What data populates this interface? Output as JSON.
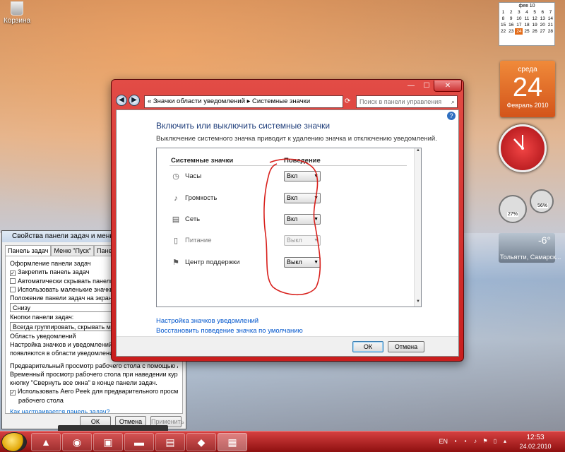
{
  "desktop": {
    "recycle_bin_label": "Корзина"
  },
  "gadgets": {
    "calendar_mini": {
      "month": "фев 10",
      "weeks": [
        [
          "1",
          "2",
          "3",
          "4",
          "5",
          "6",
          "7"
        ],
        [
          "8",
          "9",
          "10",
          "11",
          "12",
          "13",
          "14"
        ],
        [
          "15",
          "16",
          "17",
          "18",
          "19",
          "20",
          "21"
        ],
        [
          "22",
          "23",
          "24",
          "25",
          "26",
          "27",
          "28"
        ]
      ],
      "selected": "24"
    },
    "calendar_big": {
      "weekday": "среда",
      "day": "24",
      "month_year": "Февраль 2010"
    },
    "meter": {
      "cpu": "27%",
      "ram": "56%"
    },
    "weather": {
      "temp": "-6°",
      "city": "Тольятти, Самарск..."
    }
  },
  "props_dialog": {
    "title": "Свойства панели задач и меню \"Пуск\"",
    "tabs": [
      "Панель задач",
      "Меню \"Пуск\"",
      "Панели инстр"
    ],
    "section1": "Оформление панели задач",
    "checks": [
      {
        "label": "Закрепить панель задач",
        "checked": true
      },
      {
        "label": "Автоматически скрывать панель задач",
        "checked": false
      },
      {
        "label": "Использовать маленькие значки",
        "checked": false
      }
    ],
    "position_label": "Положение панели задач на экране:",
    "position_value": "Снизу",
    "buttons_label": "Кнопки панели задач:",
    "buttons_value": "Всегда группировать, скрывать метки",
    "notify_section": "Область уведомлений",
    "notify_text1": "Настройка значков и уведомлений, котор",
    "notify_text2": "появляются в области уведомлений.",
    "aero_section": "Предварительный просмотр рабочего стола с помощью Aero Peek",
    "aero_text1": "Временный просмотр рабочего стола при наведении курсора на",
    "aero_text2": "кнопку \"Свернуть все окна\" в конце панели задач.",
    "aero_check1": "Использовать Aero Peek для предварительного просмотра",
    "aero_check2": "рабочего стола",
    "help_link": "Как настраивается панель задач?",
    "ok": "ОК",
    "cancel": "Отмена",
    "apply": "Применить"
  },
  "main_window": {
    "breadcrumb": "« Значки области уведомлений ▸ Системные значки",
    "search_placeholder": "Поиск в панели управления",
    "heading": "Включить или выключить системные значки",
    "description": "Выключение системного значка приводит к удалению значка и отключению уведомлений.",
    "col_icons": "Системные значки",
    "col_behavior": "Поведение",
    "rows": [
      {
        "name": "Часы",
        "value": "Вкл",
        "icon": "clock-icon",
        "enabled": true
      },
      {
        "name": "Громкость",
        "value": "Вкл",
        "icon": "speaker-icon",
        "enabled": true
      },
      {
        "name": "Сеть",
        "value": "Вкл",
        "icon": "network-icon",
        "enabled": true
      },
      {
        "name": "Питание",
        "value": "Выкл",
        "icon": "power-icon",
        "enabled": false
      },
      {
        "name": "Центр поддержки",
        "value": "Выкл",
        "icon": "flag-icon",
        "enabled": true
      }
    ],
    "link_customize": "Настройка значков уведомлений",
    "link_restore": "Восстановить поведение значка по умолчанию",
    "ok": "ОК",
    "cancel": "Отмена"
  },
  "taskbar": {
    "lang": "EN",
    "time": "12:53",
    "date": "24.02.2010"
  }
}
